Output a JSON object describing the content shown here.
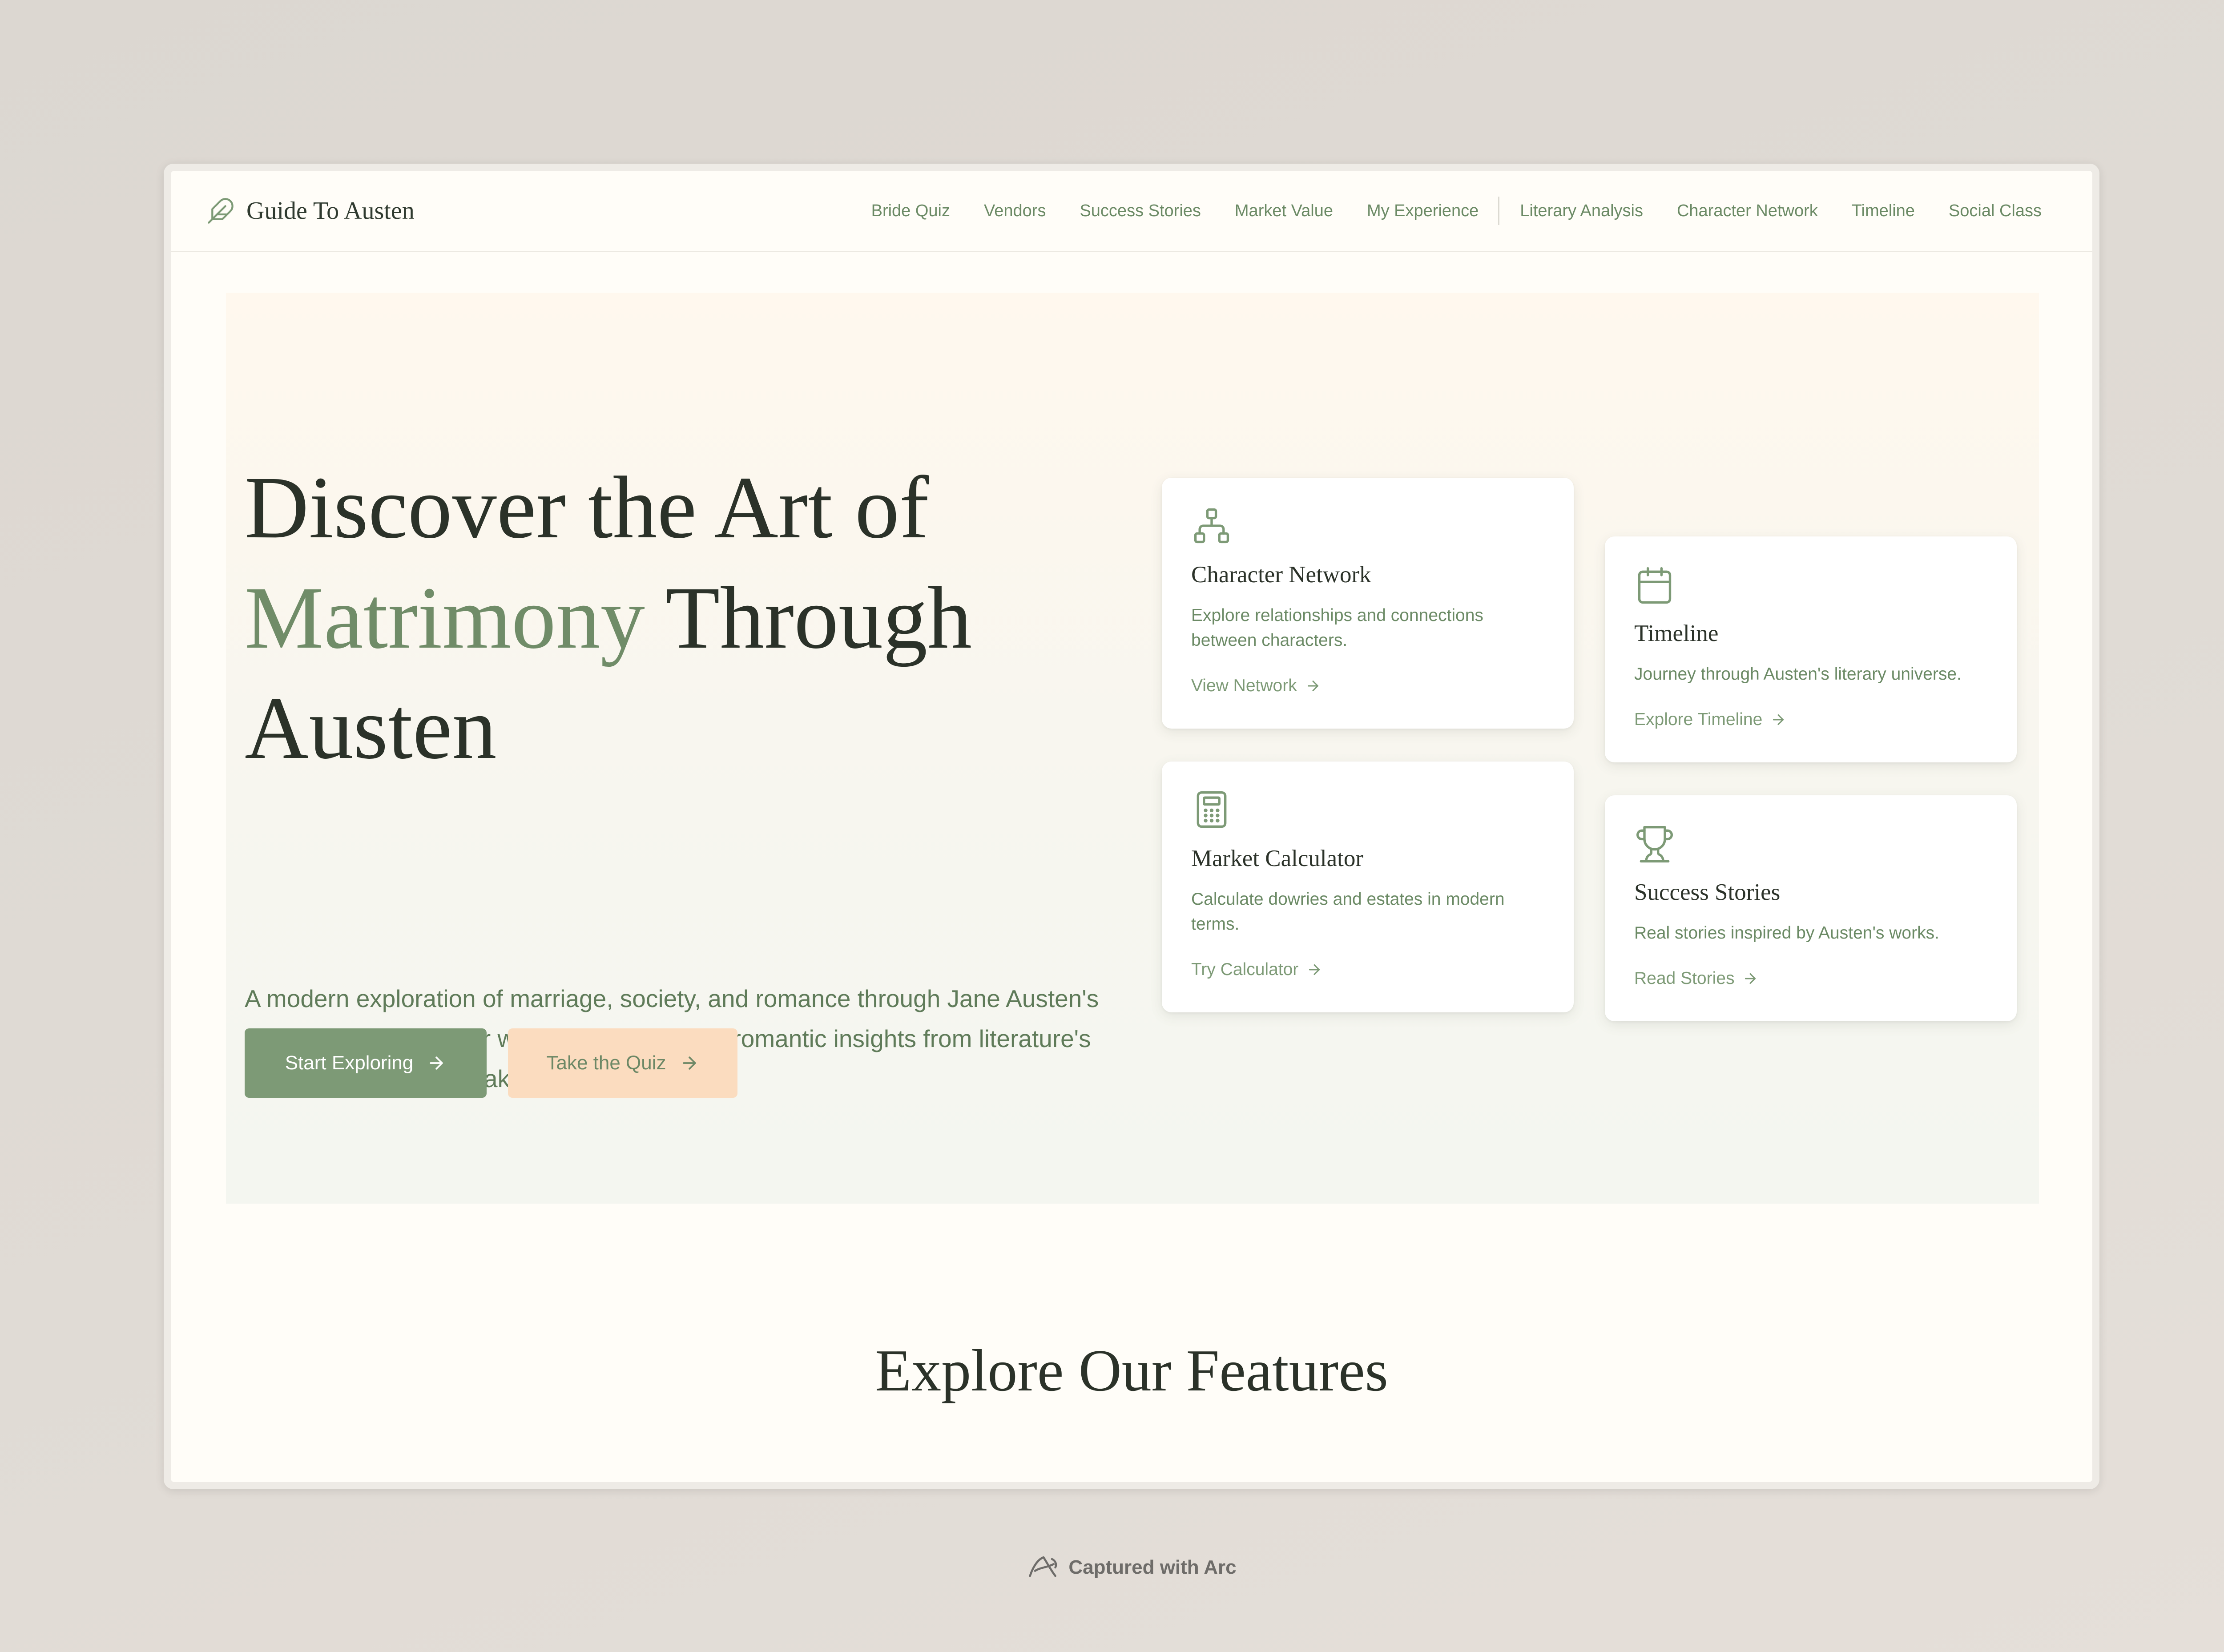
{
  "brand": {
    "name": "Guide To Austen",
    "icon": "feather-icon",
    "accent_color": "#7d9a76",
    "peach_color": "#fbdcbf"
  },
  "nav": {
    "items": [
      {
        "label": "Bride Quiz"
      },
      {
        "label": "Vendors"
      },
      {
        "label": "Success Stories"
      },
      {
        "label": "Market Value"
      },
      {
        "label": "My Experience"
      },
      {
        "label": "Literary Analysis"
      },
      {
        "label": "Character Network"
      },
      {
        "label": "Timeline"
      },
      {
        "label": "Social Class"
      }
    ]
  },
  "hero": {
    "title_line1": "Discover the Art of",
    "title_accent": "Matrimony",
    "title_line2_rest": "Through",
    "title_line3": "Austen",
    "description": "A modern exploration of marriage, society, and romance through Jane Austen's timeless lens. Uncover wedding wisdom and romantic insights from literature's most beloved matchmaker.",
    "primary_button": "Start Exploring",
    "secondary_button": "Take the Quiz"
  },
  "cards": [
    {
      "icon": "network-icon",
      "title": "Character Network",
      "description": "Explore relationships and connections between characters.",
      "link": "View Network"
    },
    {
      "icon": "calendar-icon",
      "title": "Timeline",
      "description": "Journey through Austen's literary universe.",
      "link": "Explore Timeline"
    },
    {
      "icon": "calculator-icon",
      "title": "Market Calculator",
      "description": "Calculate dowries and estates in modern terms.",
      "link": "Try Calculator"
    },
    {
      "icon": "trophy-icon",
      "title": "Success Stories",
      "description": "Real stories inspired by Austen's works.",
      "link": "Read Stories"
    }
  ],
  "features": {
    "title": "Explore Our Features"
  },
  "caption": {
    "text": "Captured with Arc",
    "icon": "arc-logo-icon"
  }
}
